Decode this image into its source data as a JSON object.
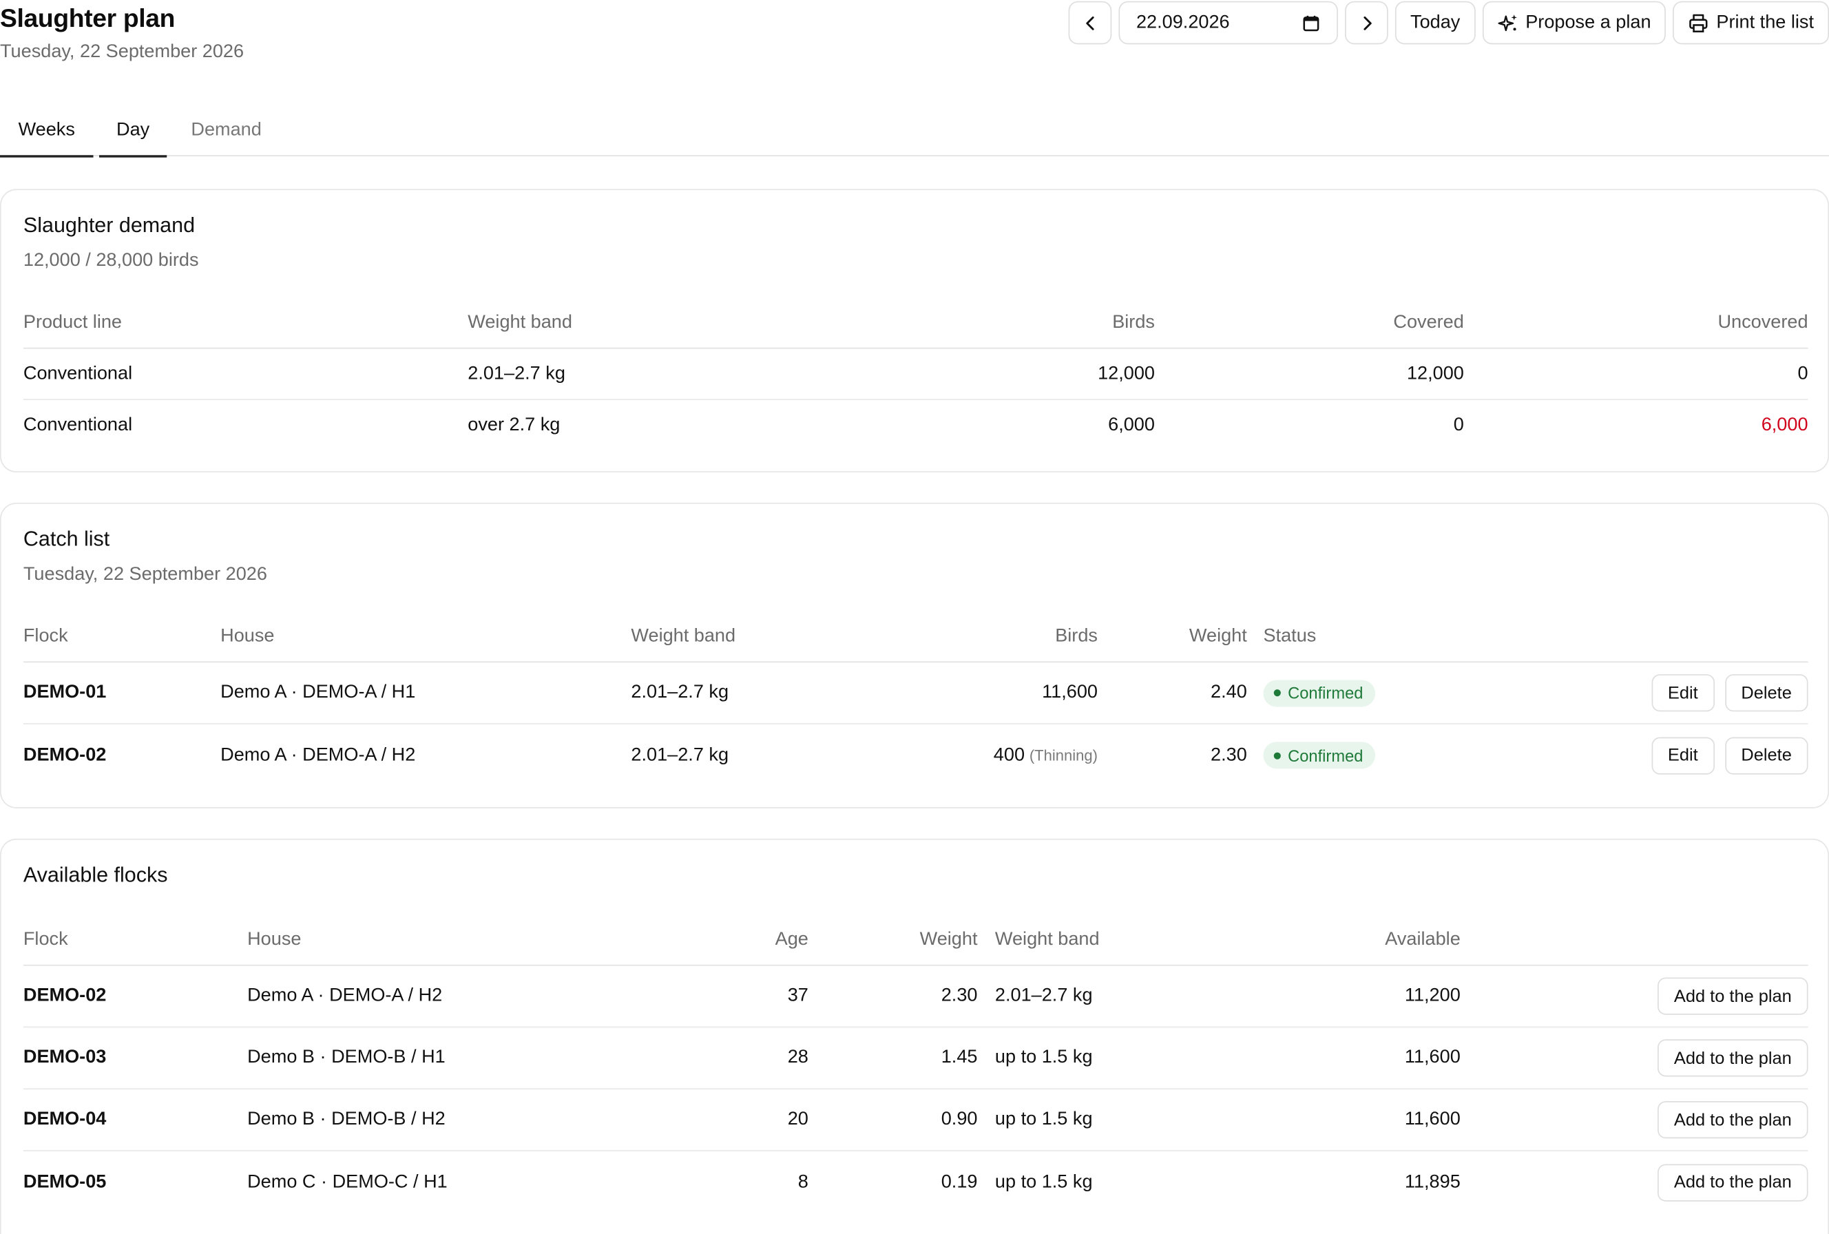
{
  "header": {
    "title": "Slaughter plan",
    "subtitle": "Tuesday, 22 September 2026"
  },
  "toolbar": {
    "prev_icon": "chevron-left-icon",
    "date_value": "22.09.2026",
    "calendar_icon": "calendar-icon",
    "next_icon": "chevron-right-icon",
    "today_label": "Today",
    "propose_label": "Propose a plan",
    "propose_icon": "sparkles-icon",
    "print_label": "Print the list",
    "print_icon": "printer-icon"
  },
  "tabs": [
    {
      "label": "Weeks",
      "active": true
    },
    {
      "label": "Day",
      "active": true
    },
    {
      "label": "Demand",
      "active": false
    }
  ],
  "demand": {
    "title": "Slaughter demand",
    "summary": "12,000 / 28,000 birds",
    "columns": {
      "product_line": "Product line",
      "weight_band": "Weight band",
      "birds": "Birds",
      "covered": "Covered",
      "uncovered": "Uncovered"
    },
    "rows": [
      {
        "product_line": "Conventional",
        "weight_band": "2.01–2.7 kg",
        "birds": "12,000",
        "covered": "12,000",
        "uncovered": "0"
      },
      {
        "product_line": "Conventional",
        "weight_band": "over 2.7 kg",
        "birds": "6,000",
        "covered": "0",
        "uncovered": "6,000"
      }
    ],
    "alert_color": "#d0021b"
  },
  "catch": {
    "title": "Catch list",
    "date": "Tuesday, 22 September 2026",
    "columns": {
      "flock": "Flock",
      "house": "House",
      "weight_band": "Weight band",
      "birds": "Birds",
      "weight": "Weight",
      "status": "Status"
    },
    "rows": [
      {
        "flock": "DEMO-01",
        "house": "Demo A · DEMO-A / H1",
        "weight_band": "2.01–2.7 kg",
        "birds": "11,600",
        "note": "",
        "weight": "2.40",
        "status": "Confirmed"
      },
      {
        "flock": "DEMO-02",
        "house": "Demo A · DEMO-A / H2",
        "weight_band": "2.01–2.7 kg",
        "birds": "400",
        "note": "(Thinning)",
        "weight": "2.30",
        "status": "Confirmed"
      }
    ],
    "edit_label": "Edit",
    "delete_label": "Delete",
    "status_color": "#1f7a3a"
  },
  "available": {
    "title": "Available flocks",
    "columns": {
      "flock": "Flock",
      "house": "House",
      "age": "Age",
      "weight": "Weight",
      "weight_band": "Weight band",
      "available": "Available"
    },
    "rows": [
      {
        "flock": "DEMO-02",
        "house": "Demo A · DEMO-A / H2",
        "age": "37",
        "weight": "2.30",
        "weight_band": "2.01–2.7 kg",
        "available": "11,200"
      },
      {
        "flock": "DEMO-03",
        "house": "Demo B · DEMO-B / H1",
        "age": "28",
        "weight": "1.45",
        "weight_band": "up to 1.5 kg",
        "available": "11,600"
      },
      {
        "flock": "DEMO-04",
        "house": "Demo B · DEMO-B / H2",
        "age": "20",
        "weight": "0.90",
        "weight_band": "up to 1.5 kg",
        "available": "11,600"
      },
      {
        "flock": "DEMO-05",
        "house": "Demo C · DEMO-C / H1",
        "age": "8",
        "weight": "0.19",
        "weight_band": "up to 1.5 kg",
        "available": "11,895"
      }
    ],
    "add_label": "Add to the plan"
  }
}
